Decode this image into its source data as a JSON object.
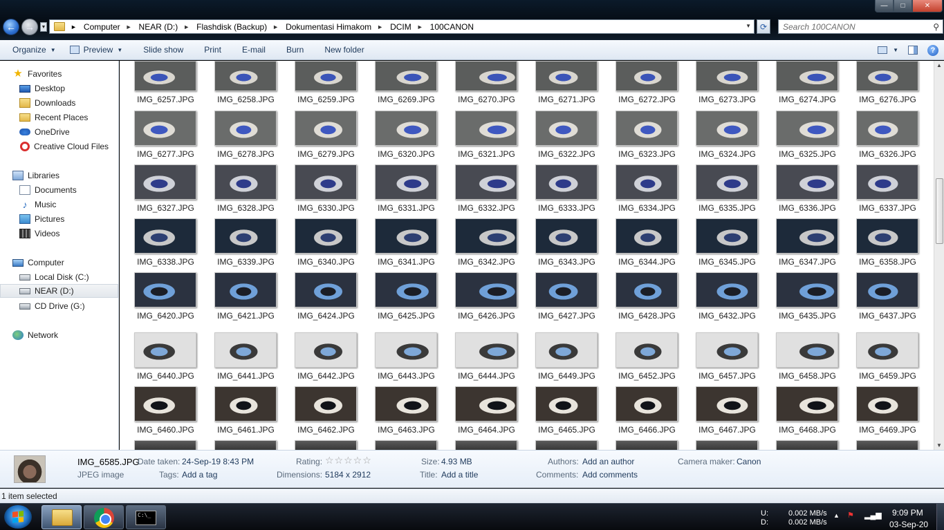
{
  "window": {
    "breadcrumbs": [
      "Computer",
      "NEAR (D:)",
      "Flashdisk (Backup)",
      "Dokumentasi Himakom",
      "DCIM",
      "100CANON"
    ],
    "search_placeholder": "Search 100CANON",
    "min_label": "—",
    "max_label": "□",
    "close_label": "✕"
  },
  "toolbar": {
    "organize": "Organize",
    "preview": "Preview",
    "slideshow": "Slide show",
    "print": "Print",
    "email": "E-mail",
    "burn": "Burn",
    "new_folder": "New folder"
  },
  "sidebar": {
    "favorites": {
      "label": "Favorites",
      "items": [
        "Desktop",
        "Downloads",
        "Recent Places",
        "OneDrive",
        "Creative Cloud Files"
      ]
    },
    "libraries": {
      "label": "Libraries",
      "items": [
        "Documents",
        "Music",
        "Pictures",
        "Videos"
      ]
    },
    "computer": {
      "label": "Computer",
      "items": [
        "Local Disk (C:)",
        "NEAR (D:)",
        "CD Drive (G:)"
      ],
      "selected": "NEAR (D:)"
    },
    "network": {
      "label": "Network"
    }
  },
  "files": [
    [
      "IMG_6257.JPG",
      "IMG_6258.JPG",
      "IMG_6259.JPG",
      "IMG_6269.JPG",
      "IMG_6270.JPG",
      "IMG_6271.JPG",
      "IMG_6272.JPG",
      "IMG_6273.JPG",
      "IMG_6274.JPG",
      "IMG_6276.JPG"
    ],
    [
      "IMG_6277.JPG",
      "IMG_6278.JPG",
      "IMG_6279.JPG",
      "IMG_6320.JPG",
      "IMG_6321.JPG",
      "IMG_6322.JPG",
      "IMG_6323.JPG",
      "IMG_6324.JPG",
      "IMG_6325.JPG",
      "IMG_6326.JPG"
    ],
    [
      "IMG_6327.JPG",
      "IMG_6328.JPG",
      "IMG_6330.JPG",
      "IMG_6331.JPG",
      "IMG_6332.JPG",
      "IMG_6333.JPG",
      "IMG_6334.JPG",
      "IMG_6335.JPG",
      "IMG_6336.JPG",
      "IMG_6337.JPG"
    ],
    [
      "IMG_6338.JPG",
      "IMG_6339.JPG",
      "IMG_6340.JPG",
      "IMG_6341.JPG",
      "IMG_6342.JPG",
      "IMG_6343.JPG",
      "IMG_6344.JPG",
      "IMG_6345.JPG",
      "IMG_6347.JPG",
      "IMG_6358.JPG"
    ],
    [
      "IMG_6420.JPG",
      "IMG_6421.JPG",
      "IMG_6424.JPG",
      "IMG_6425.JPG",
      "IMG_6426.JPG",
      "IMG_6427.JPG",
      "IMG_6428.JPG",
      "IMG_6432.JPG",
      "IMG_6435.JPG",
      "IMG_6437.JPG"
    ],
    [
      "IMG_6440.JPG",
      "IMG_6441.JPG",
      "IMG_6442.JPG",
      "IMG_6443.JPG",
      "IMG_6444.JPG",
      "IMG_6449.JPG",
      "IMG_6452.JPG",
      "IMG_6457.JPG",
      "IMG_6458.JPG",
      "IMG_6459.JPG"
    ],
    [
      "IMG_6460.JPG",
      "IMG_6461.JPG",
      "IMG_6462.JPG",
      "IMG_6463.JPG",
      "IMG_6464.JPG",
      "IMG_6465.JPG",
      "IMG_6466.JPG",
      "IMG_6467.JPG",
      "IMG_6468.JPG",
      "IMG_6469.JPG"
    ]
  ],
  "details": {
    "filename": "IMG_6585.JPG",
    "type": "JPEG image",
    "date_taken_label": "Date taken:",
    "date_taken": "24-Sep-19 8:43 PM",
    "tags_label": "Tags:",
    "tags": "Add a tag",
    "rating_label": "Rating:",
    "rating_stars": "☆☆☆☆☆",
    "dimensions_label": "Dimensions:",
    "dimensions": "5184 x 2912",
    "size_label": "Size:",
    "size": "4.93 MB",
    "title_label": "Title:",
    "title": "Add a title",
    "authors_label": "Authors:",
    "authors": "Add an author",
    "comments_label": "Comments:",
    "comments": "Add comments",
    "camera_maker_label": "Camera maker:",
    "camera_maker": "Canon"
  },
  "status": "1 item selected",
  "taskbar": {
    "up_label": "U:",
    "down_label": "D:",
    "up_speed": "0.002 MB/s",
    "down_speed": "0.002 MB/s",
    "time": "9:09 PM",
    "date": "03-Sep-20",
    "cmd_text": "C:\\_"
  }
}
